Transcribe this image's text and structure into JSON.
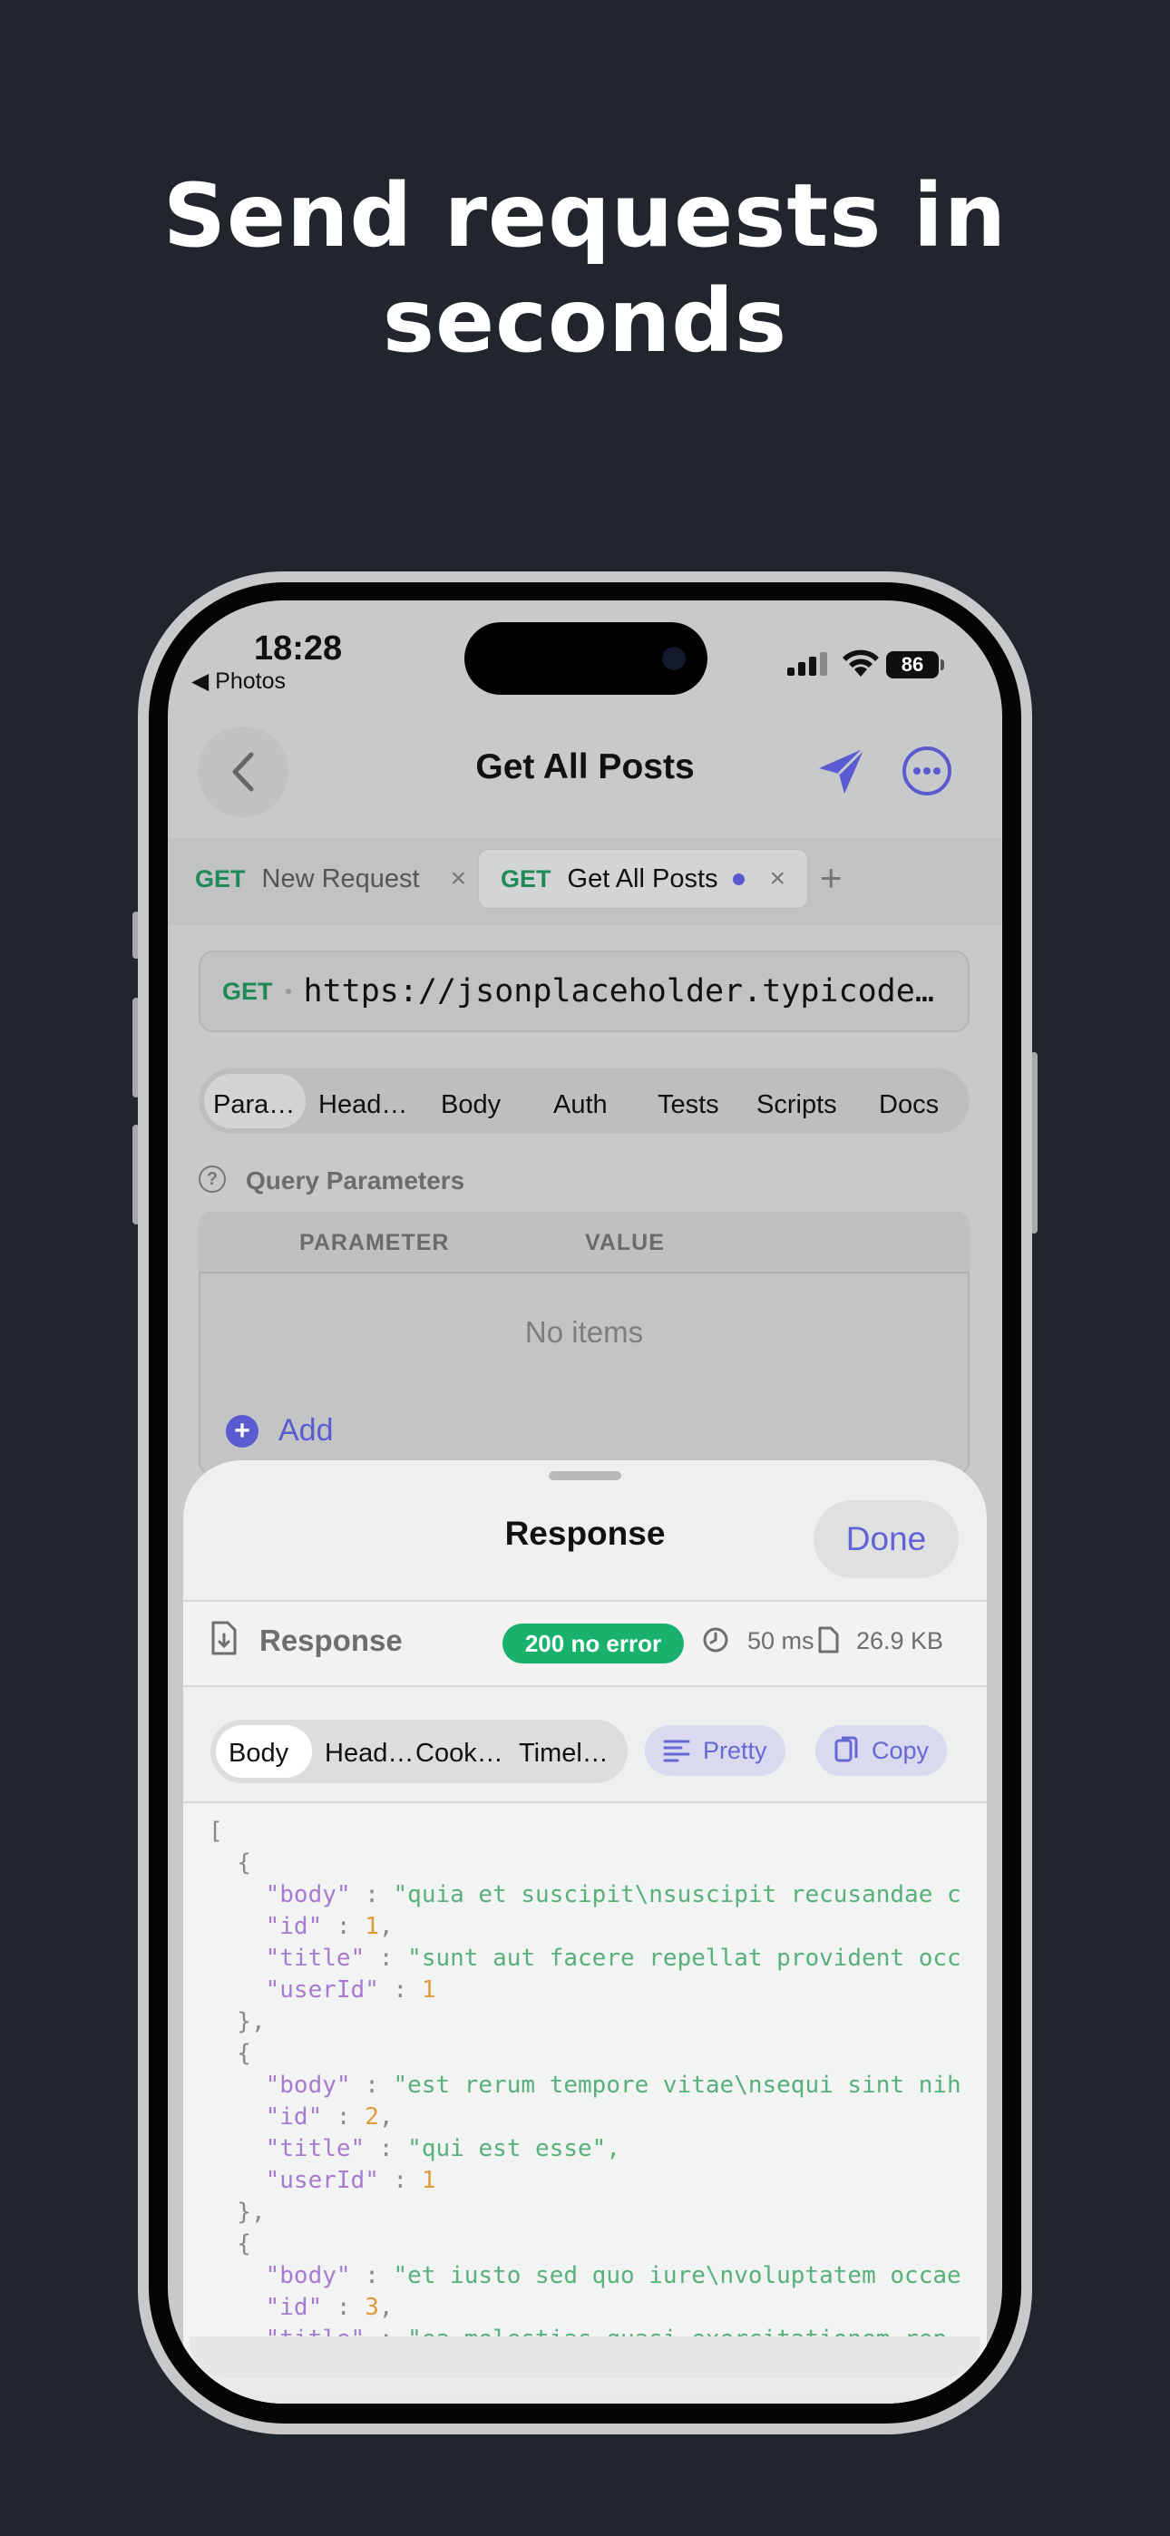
{
  "headline": {
    "line1": "Send requests in",
    "line2": "seconds"
  },
  "status_bar": {
    "time": "18:28",
    "back_app": "◀ Photos",
    "battery": "86"
  },
  "nav": {
    "title": "Get All Posts"
  },
  "tabs": [
    {
      "method": "GET",
      "name": "New Request",
      "close": "×"
    },
    {
      "method": "GET",
      "name": "Get All Posts",
      "close": "×"
    }
  ],
  "tab_add": "+",
  "url": {
    "method": "GET",
    "text": "https://jsonplaceholder.typicode…"
  },
  "request_tabs": [
    "Para…",
    "Head…",
    "Body",
    "Auth",
    "Tests",
    "Scripts",
    "Docs"
  ],
  "query": {
    "help_icon": "?",
    "title": "Query Parameters",
    "col_parameter": "PARAMETER",
    "col_value": "VALUE",
    "empty": "No items",
    "add_icon": "+",
    "add_label": "Add"
  },
  "sheet": {
    "title": "Response",
    "done": "Done",
    "response_label": "Response",
    "status": "200 no error",
    "time": "50 ms",
    "size": "26.9 KB",
    "tabs": [
      "Body",
      "Head…",
      "Cook…",
      "Timel…"
    ],
    "pretty": "Pretty",
    "copy": "Copy"
  },
  "code_lines": [
    "[",
    "  {",
    "    \"body\" : \"quia et suscipit\\nsuscipit recusandae c",
    "    \"id\" : 1,",
    "    \"title\" : \"sunt aut facere repellat provident occ",
    "    \"userId\" : 1",
    "  },",
    "  {",
    "    \"body\" : \"est rerum tempore vitae\\nsequi sint nih",
    "    \"id\" : 2,",
    "    \"title\" : \"qui est esse\",",
    "    \"userId\" : 1",
    "  },",
    "  {",
    "    \"body\" : \"et iusto sed quo iure\\nvoluptatem occae",
    "    \"id\" : 3,",
    "    \"title\" : \"ea molestias quasi exercitationem rep"
  ],
  "colors": {
    "accent": "#5a5ad1",
    "get_method": "#1f8a57",
    "status_ok": "#18b26d",
    "background": "#21252c"
  }
}
